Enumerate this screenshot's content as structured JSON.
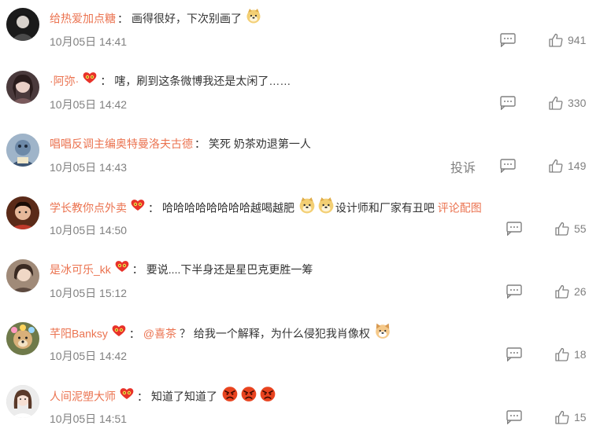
{
  "colors": {
    "username": "#eb7350",
    "meta": "#808080",
    "text": "#333333",
    "background": "#ffffff"
  },
  "comments": [
    {
      "username": "给热爱加点糖",
      "colon": "：",
      "text": "画得很好，下次别画了",
      "time": "10月05日 14:41",
      "likes": "941",
      "report": ""
    },
    {
      "username": "·阿弥·",
      "colon": "：",
      "text": "嗐，刷到这条微博我还是太闲了……",
      "time": "10月05日 14:42",
      "likes": "330",
      "report": ""
    },
    {
      "username": "唱唱反调主编奥特曼洛夫古德",
      "colon": "：",
      "text": "笑死 奶茶劝退第一人",
      "time": "10月05日 14:43",
      "likes": "149",
      "report": "投诉"
    },
    {
      "username": "学长教你点外卖",
      "colon": "：",
      "text": "哈哈哈哈哈哈哈哈越喝越肥",
      "text2": "设计师和厂家有丑吧",
      "link": "评论配图",
      "time": "10月05日 14:50",
      "likes": "55",
      "report": ""
    },
    {
      "username": "是冰可乐_kk",
      "colon": "：",
      "text": "要说....下半身还是星巴克更胜一筹",
      "time": "10月05日 15:12",
      "likes": "26",
      "report": ""
    },
    {
      "username": "芊阳Banksy",
      "colon": "：",
      "mention": "@喜茶",
      "text": " ？ 给我一个解释，为什么侵犯我肖像权",
      "time": "10月05日 14:42",
      "likes": "18",
      "report": ""
    },
    {
      "username": "人间泥塑大师",
      "colon": "：",
      "text": "知道了知道了",
      "time": "10月05日 14:51",
      "likes": "15",
      "report": ""
    }
  ]
}
